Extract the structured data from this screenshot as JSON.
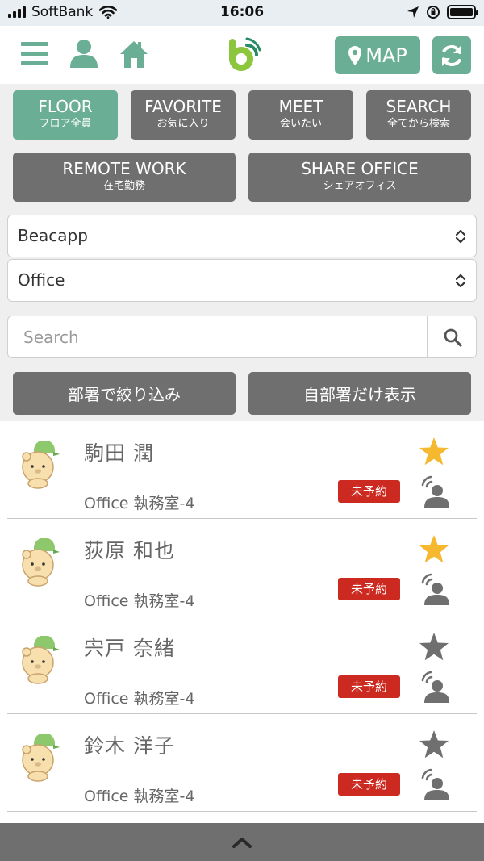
{
  "status_bar": {
    "carrier": "SoftBank",
    "time": "16:06"
  },
  "nav": {
    "map_label": "MAP"
  },
  "tabs": [
    {
      "en": "FLOOR",
      "ja": "フロア全員",
      "active": true
    },
    {
      "en": "FAVORITE",
      "ja": "お気に入り",
      "active": false
    },
    {
      "en": "MEET",
      "ja": "会いたい",
      "active": false
    },
    {
      "en": "SEARCH",
      "ja": "全てから検索",
      "active": false
    },
    {
      "en": "REMOTE WORK",
      "ja": "在宅勤務",
      "active": false
    },
    {
      "en": "SHARE OFFICE",
      "ja": "シェアオフィス",
      "active": false
    }
  ],
  "selects": {
    "company": "Beacapp",
    "location": "Office"
  },
  "search": {
    "placeholder": "Search",
    "value": ""
  },
  "filters": {
    "by_department": "部署で絞り込み",
    "own_department_only": "自部署だけ表示"
  },
  "people": [
    {
      "name": "駒田 潤",
      "location": "Office 執務室-4",
      "badge": "未予約",
      "favorite": true
    },
    {
      "name": "荻原 和也",
      "location": "Office 執務室-4",
      "badge": "未予約",
      "favorite": true
    },
    {
      "name": "宍戸 奈緒",
      "location": "Office 執務室-4",
      "badge": "未予約",
      "favorite": false
    },
    {
      "name": "鈴木 洋子",
      "location": "Office 執務室-4",
      "badge": "未予約",
      "favorite": false
    }
  ],
  "colors": {
    "brand": "#6aae96",
    "tab_inactive": "#6f6f6f",
    "badge": "#cc2a20",
    "star_active": "#f5b82e",
    "star_inactive": "#6f6f6f"
  },
  "icons": {
    "menu": "hamburger-icon",
    "profile": "user-icon",
    "home": "home-icon",
    "logo": "beacapp-logo",
    "map": "map-pin-icon",
    "refresh": "refresh-icon",
    "search": "search-icon",
    "collapse": "chevron-up-icon"
  }
}
